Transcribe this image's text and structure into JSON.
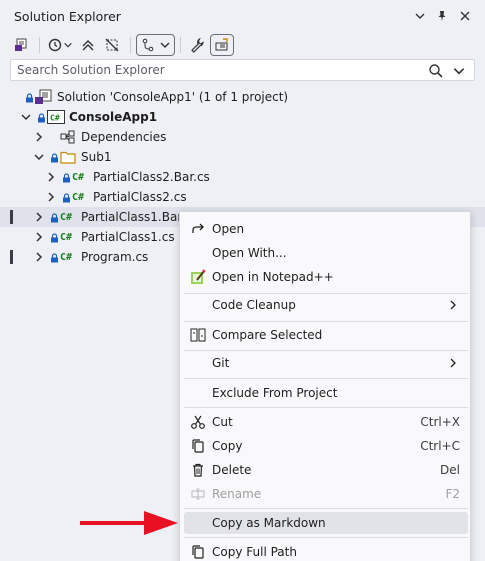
{
  "window": {
    "title": "Solution Explorer"
  },
  "search": {
    "placeholder": "Search Solution Explorer"
  },
  "tree": {
    "solution_label": "Solution 'ConsoleApp1' (1 of 1 project)",
    "project_label": "ConsoleApp1",
    "dependencies_label": "Dependencies",
    "folder_label": "Sub1",
    "file_partial2_bar": "PartialClass2.Bar.cs",
    "file_partial2": "PartialClass2.cs",
    "file_partial1_bar": "PartialClass1.Bar.cs",
    "file_partial1": "PartialClass1.cs",
    "file_program": "Program.cs",
    "cs_badge": "C#"
  },
  "menu": {
    "open": "Open",
    "open_with": "Open With...",
    "open_notepad": "Open in Notepad++",
    "code_cleanup": "Code Cleanup",
    "compare_selected": "Compare Selected",
    "git": "Git",
    "exclude": "Exclude From Project",
    "cut": "Cut",
    "cut_shortcut": "Ctrl+X",
    "copy": "Copy",
    "copy_shortcut": "Ctrl+C",
    "delete": "Delete",
    "delete_shortcut": "Del",
    "rename": "Rename",
    "rename_shortcut": "F2",
    "copy_markdown": "Copy as Markdown",
    "copy_full_path": "Copy Full Path"
  },
  "colors": {
    "accent": "#5c2d91",
    "csharp_green": "#1e7d1e",
    "lock_blue": "#1f5fbf",
    "annotation_red": "#e81123"
  }
}
